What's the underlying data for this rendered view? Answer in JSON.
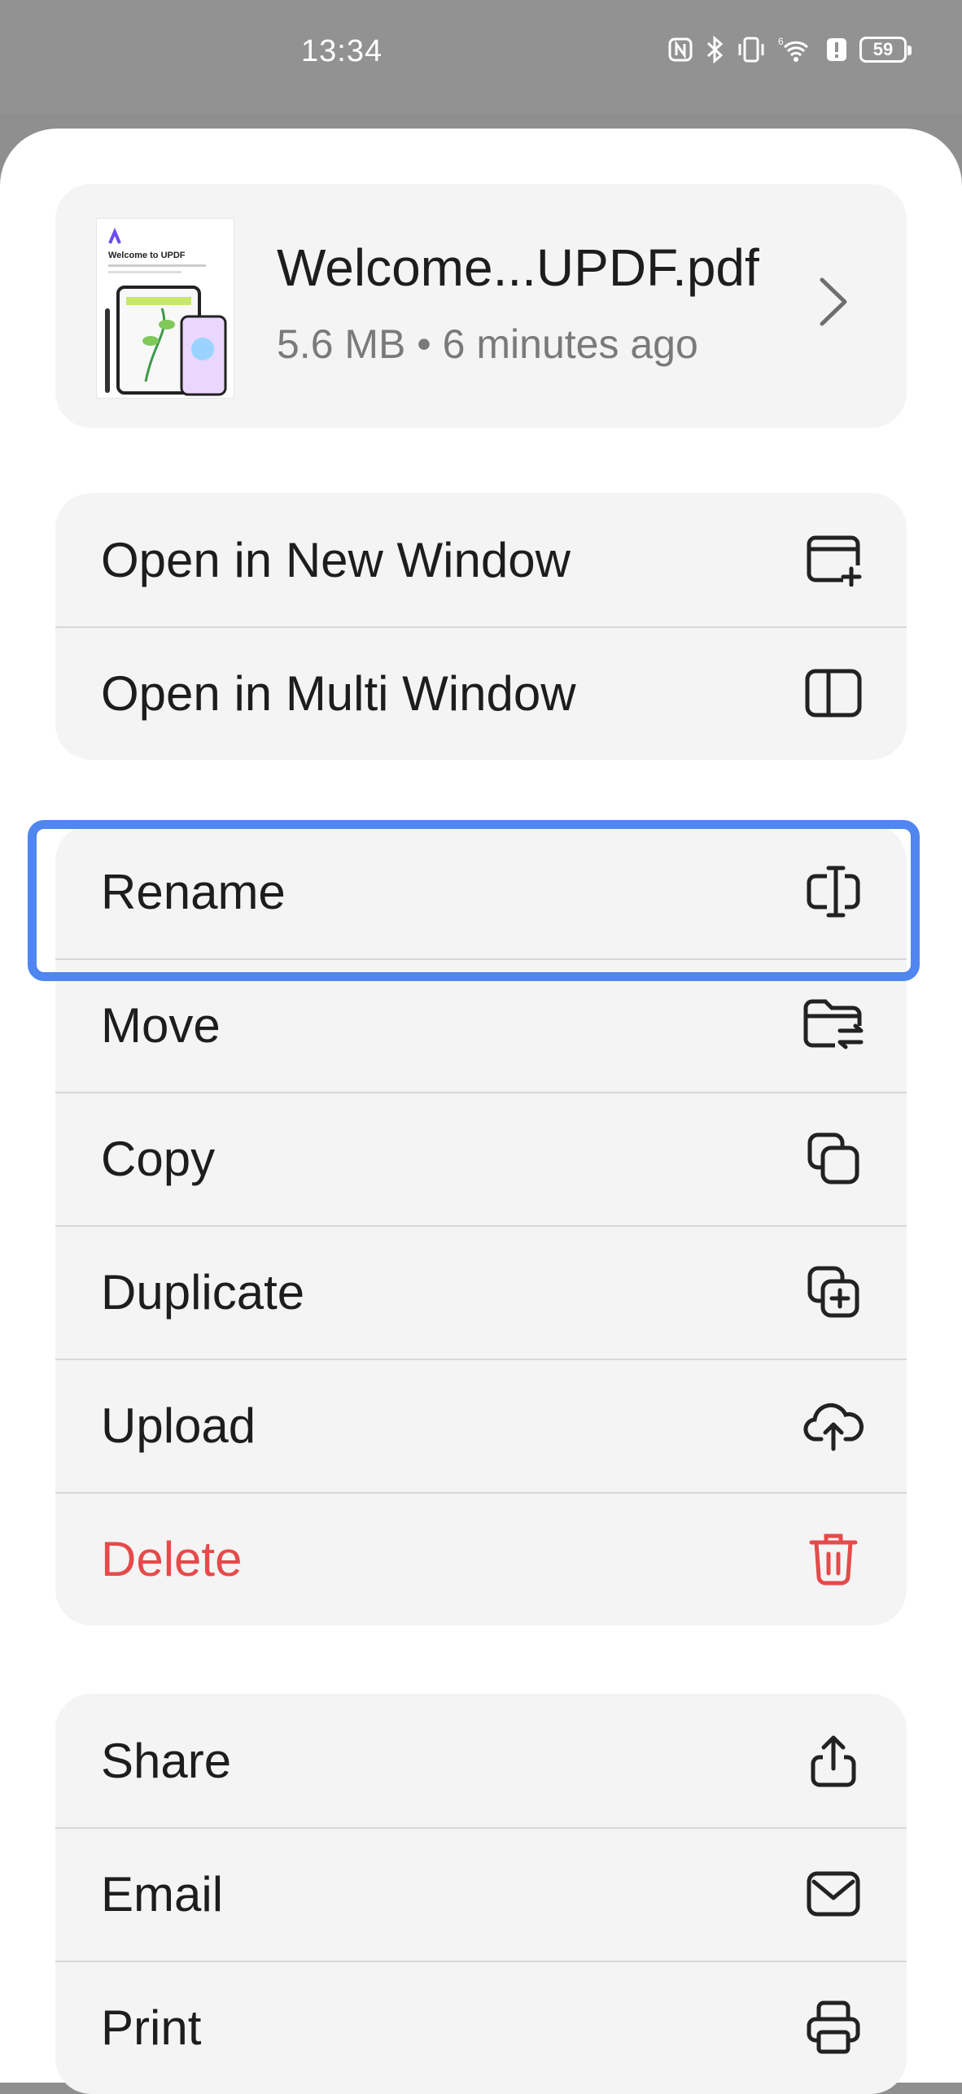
{
  "status_bar": {
    "time": "13:34",
    "battery": "59",
    "icons": [
      "nfc-icon",
      "bluetooth-icon",
      "vibrate-icon",
      "signal-6-icon",
      "wifi-icon",
      "alert-icon",
      "battery-icon"
    ]
  },
  "file": {
    "name": "Welcome...UPDF.pdf",
    "meta": "5.6 MB • 6 minutes ago",
    "thumbnail_title": "Welcome to UPDF"
  },
  "group_window": [
    {
      "label": "Open in New Window",
      "icon": "new-window-icon"
    },
    {
      "label": "Open in Multi Window",
      "icon": "multi-window-icon"
    }
  ],
  "group_file_ops": [
    {
      "label": "Rename",
      "icon": "rename-icon"
    },
    {
      "label": "Move",
      "icon": "folder-move-icon",
      "highlighted": true
    },
    {
      "label": "Copy",
      "icon": "copy-icon"
    },
    {
      "label": "Duplicate",
      "icon": "duplicate-icon"
    },
    {
      "label": "Upload",
      "icon": "cloud-upload-icon"
    },
    {
      "label": "Delete",
      "icon": "trash-icon",
      "color": "#e64a4a"
    }
  ],
  "group_share": [
    {
      "label": "Share",
      "icon": "share-icon"
    },
    {
      "label": "Email",
      "icon": "mail-icon"
    },
    {
      "label": "Print",
      "icon": "printer-icon"
    }
  ],
  "colors": {
    "highlight": "#4f86f0",
    "danger": "#e64a4a",
    "card_bg": "#f4f4f4"
  }
}
